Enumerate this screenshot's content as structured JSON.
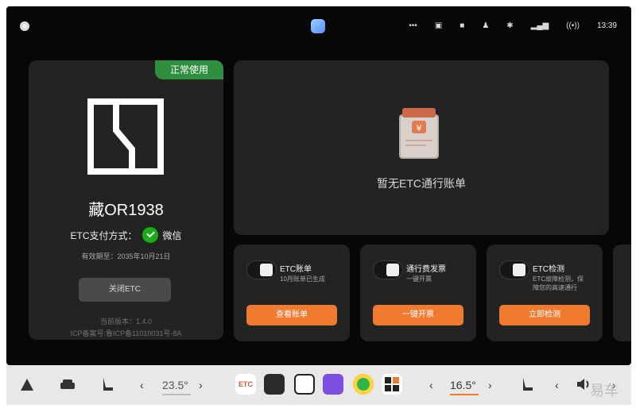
{
  "status_bar": {
    "icons": [
      "more-icon",
      "cast-icon",
      "camera-icon",
      "person-icon",
      "bluetooth-icon",
      "signal-icon",
      "wireless-icon"
    ],
    "icon_glyphs": [
      "•••",
      "▣",
      "■",
      "♟",
      "✱",
      "▂▄▆",
      "((•))"
    ],
    "time": "13:39"
  },
  "etc_card": {
    "status_badge": "正常使用",
    "plate": "藏OR1938",
    "payment_label": "ETC支付方式：",
    "payment_method": "微信",
    "expiry": "有效期至：2035年10月21日",
    "close_button": "关闭ETC",
    "version": "当前版本：1.4.0",
    "icp": "ICP备案号:鲁ICP备11010031号-8A"
  },
  "bill_panel": {
    "empty_text": "暂无ETC通行账单"
  },
  "services": [
    {
      "title": "ETC账单",
      "subtitle": "10月账单已生成",
      "button": "查看账单",
      "icon": "bill-icon"
    },
    {
      "title": "通行费发票",
      "subtitle": "一键开票",
      "button": "一键开票",
      "icon": "invoice-icon"
    },
    {
      "title": "ETC检测",
      "subtitle": "ETC故障检测，保障您的高速通行",
      "button": "立即检测",
      "icon": "shield-check-icon"
    }
  ],
  "dock": {
    "left_temp": "23.5°",
    "right_temp": "16.5°",
    "left_prev": "‹",
    "left_next": "›",
    "right_prev": "‹",
    "right_next": "›",
    "vol_prev": "‹",
    "vol_next": "›",
    "apps": [
      "etc-app-icon",
      "racing-app-icon",
      "video-app-icon",
      "crown-app-icon",
      "music-app-icon",
      "apps-grid-icon"
    ],
    "etc_app_label": "ETC"
  },
  "colors": {
    "accent_orange": "#f07a2f",
    "badge_green": "#2f8f3e",
    "wechat_green": "#1aad19",
    "card_bg": "#232323"
  },
  "watermark": "易车"
}
